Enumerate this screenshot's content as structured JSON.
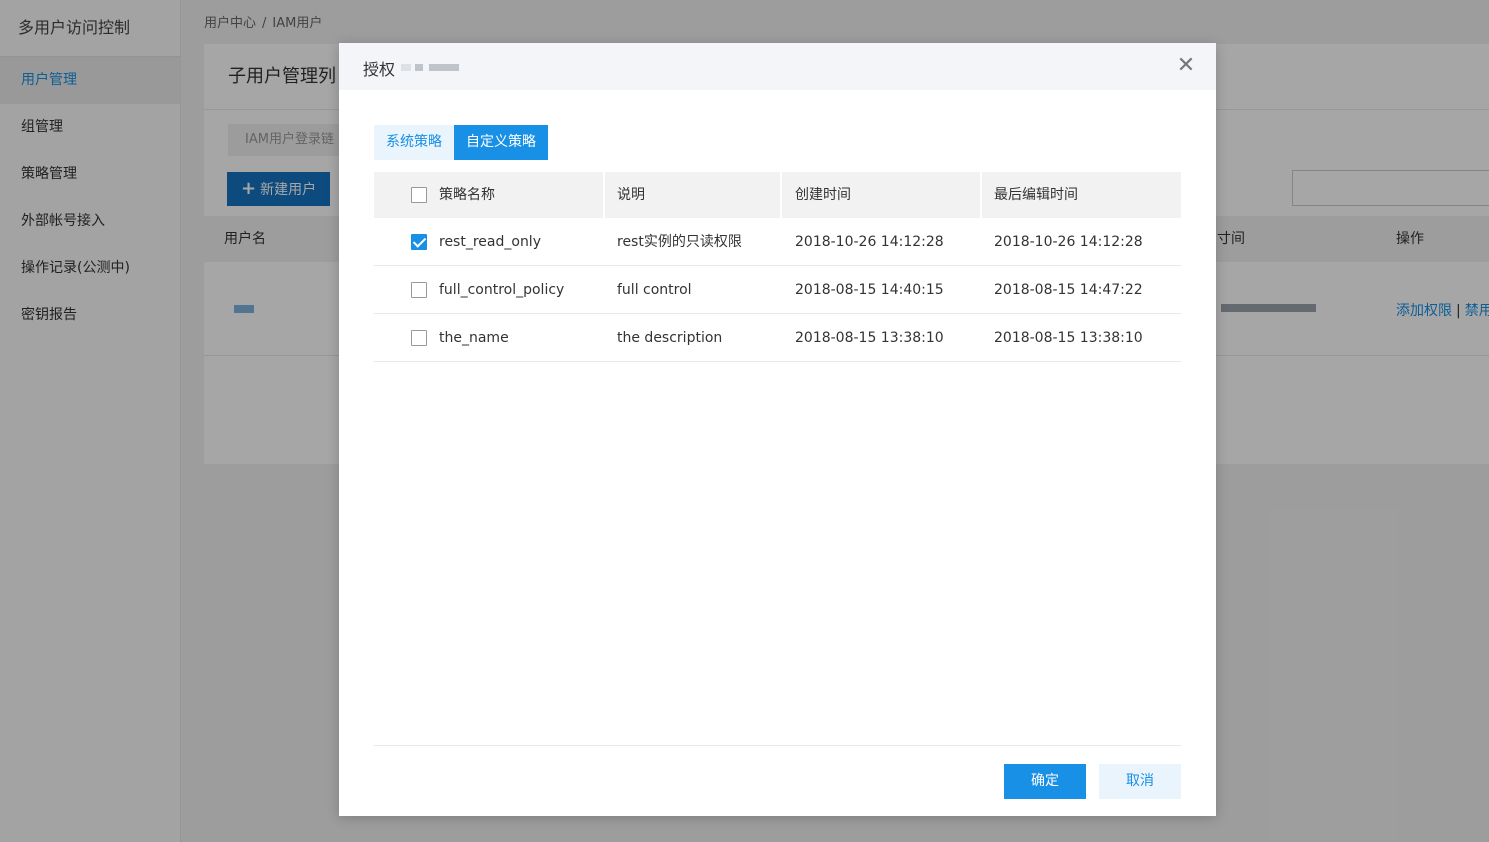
{
  "sidebar": {
    "title": "多用户访问控制",
    "items": [
      {
        "label": "用户管理",
        "active": true
      },
      {
        "label": "组管理"
      },
      {
        "label": "策略管理"
      },
      {
        "label": "外部帐号接入"
      },
      {
        "label": "操作记录(公测中)"
      },
      {
        "label": "密钥报告"
      }
    ]
  },
  "breadcrumb": {
    "root": "用户中心",
    "separator": "/",
    "current": "IAM用户"
  },
  "background": {
    "panel_title": "子用户管理列",
    "login_link": "IAM用户登录链",
    "new_user_label": "新建用户",
    "new_user_icon": "plus-icon",
    "table_headers": {
      "username": "用户名",
      "time": "寸间",
      "actions": "操作"
    },
    "row_actions": {
      "add_permission": "添加权限",
      "separator": "|",
      "disable": "禁用"
    }
  },
  "modal": {
    "title": "授权",
    "close_icon": "close-icon",
    "tabs": [
      {
        "label": "系统策略",
        "active": false
      },
      {
        "label": "自定义策略",
        "active": true
      }
    ],
    "table": {
      "headers": {
        "name": "策略名称",
        "description": "说明",
        "created": "创建时间",
        "modified": "最后编辑时间"
      },
      "rows": [
        {
          "name": "rest_read_only",
          "description": "rest实例的只读权限",
          "created": "2018-10-26 14:12:28",
          "modified": "2018-10-26 14:12:28",
          "checked": true
        },
        {
          "name": "full_control_policy",
          "description": "full control",
          "created": "2018-08-15 14:40:15",
          "modified": "2018-08-15 14:47:22",
          "checked": false
        },
        {
          "name": "the_name",
          "description": "the description",
          "created": "2018-08-15 13:38:10",
          "modified": "2018-08-15 13:38:10",
          "checked": false
        }
      ]
    },
    "footer": {
      "confirm": "确定",
      "cancel": "取消"
    }
  },
  "colors": {
    "primary": "#1890e6",
    "primary_light": "#e9f4fd",
    "overlay": "rgba(0,0,0,0.35)"
  }
}
